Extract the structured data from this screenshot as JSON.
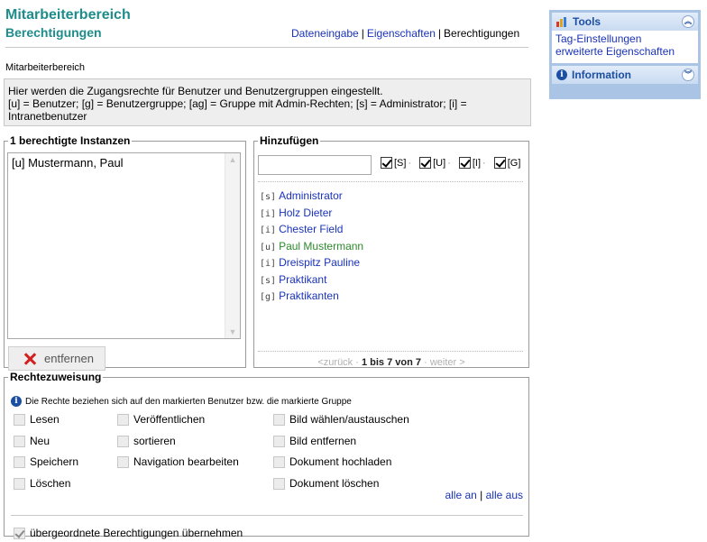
{
  "header": {
    "title": "Mitarbeiterbereich",
    "subtitle": "Berechtigungen",
    "nav": [
      {
        "label": "Dateneingabe",
        "link": true
      },
      {
        "label": "Eigenschaften",
        "link": true
      },
      {
        "label": "Berechtigungen",
        "link": false
      }
    ],
    "nav_separator": "|",
    "breadcrumb": "Mitarbeiterbereich"
  },
  "info": {
    "line1": "Hier werden die Zugangsrechte für Benutzer und Benutzergruppen eingestellt.",
    "line2": "[u] = Benutzer; [g] = Benutzergruppe; [ag] = Gruppe mit Admin-Rechten; [s] = Administrator; [i] = Intranetbenutzer"
  },
  "instances": {
    "legend": "1 berechtigte Instanzen",
    "items": [
      "[u] Mustermann, Paul"
    ],
    "remove_label": "entfernen"
  },
  "add": {
    "legend": "Hinzufügen",
    "search_value": "",
    "filters": [
      {
        "label": "[S]",
        "checked": true
      },
      {
        "label": "[U]",
        "checked": true
      },
      {
        "label": "[I]",
        "checked": true
      },
      {
        "label": "[G]",
        "checked": true
      }
    ],
    "filter_separator": "·",
    "results": [
      {
        "tag": "[s]",
        "name": "Administrator",
        "color": "#1a33b8"
      },
      {
        "tag": "[i]",
        "name": "Holz Dieter",
        "color": "#1a33b8"
      },
      {
        "tag": "[i]",
        "name": "Chester Field",
        "color": "#1a33b8"
      },
      {
        "tag": "[u]",
        "name": "Paul Mustermann",
        "color": "#2c8a2c"
      },
      {
        "tag": "[i]",
        "name": "Dreispitz Pauline",
        "color": "#1a33b8"
      },
      {
        "tag": "[s]",
        "name": "Praktikant",
        "color": "#1a33b8"
      },
      {
        "tag": "[g]",
        "name": "Praktikanten",
        "color": "#1a33b8"
      }
    ],
    "pager": {
      "prev": "<zurück",
      "sep": "·",
      "range": "1 bis 7 von 7",
      "next": "weiter >"
    }
  },
  "rights": {
    "legend": "Rechtezuweisung",
    "note": "Die Rechte beziehen sich auf den markierten Benutzer bzw. die markierte Gruppe",
    "col1": [
      "Lesen",
      "Neu",
      "Speichern",
      "Löschen"
    ],
    "col2": [
      "Veröffentlichen",
      "sortieren",
      "Navigation bearbeiten"
    ],
    "col3": [
      "Bild wählen/austauschen",
      "Bild entfernen",
      "Dokument hochladen",
      "Dokument löschen"
    ],
    "all_on": "alle an",
    "all_sep": "|",
    "all_off": "alle aus",
    "inherit_label": "übergeordnete Berechtigungen übernehmen",
    "inherit_checked": true
  },
  "sidebar": {
    "tools_title": "Tools",
    "tools_links": [
      "Tag-Einstellungen",
      "erweiterte Eigenschaften"
    ],
    "info_title": "Information"
  }
}
